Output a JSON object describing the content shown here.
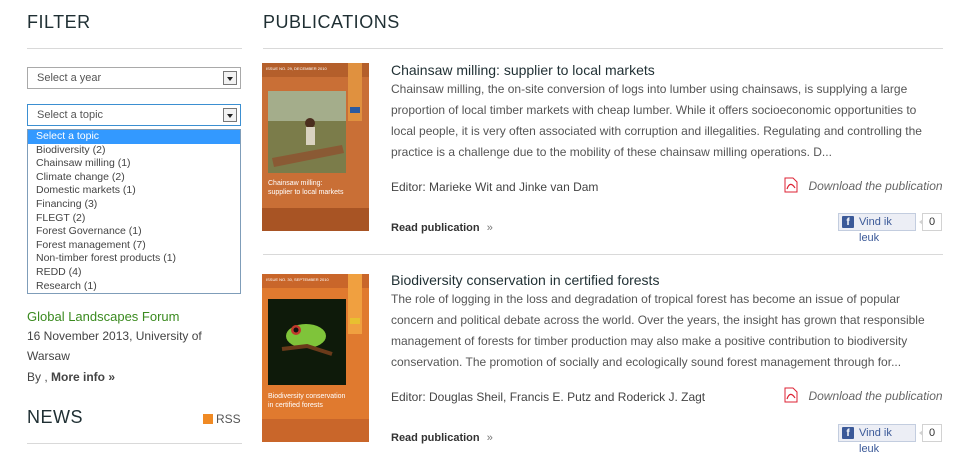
{
  "filter": {
    "heading": "FILTER",
    "year_select": "Select a year",
    "topic_select": "Select a topic",
    "topic_options": [
      "Select a topic",
      "Biodiversity (2)",
      "Chainsaw milling (1)",
      "Climate change (2)",
      "Domestic markets (1)",
      "Financing (3)",
      "FLEGT (2)",
      "Forest Governance (1)",
      "Forest management (7)",
      "Non-timber forest products (1)",
      "REDD (4)",
      "Research (1)"
    ]
  },
  "event": {
    "title": "Global Landscapes Forum",
    "date_line1": "16 November 2013, University of",
    "date_line2": "Warsaw",
    "by": "By ,",
    "more": "More info »"
  },
  "news": {
    "heading": "NEWS",
    "rss": "RSS"
  },
  "publications": {
    "heading": "PUBLICATIONS",
    "items": [
      {
        "title": "Chainsaw milling: supplier to local markets",
        "lines": [
          "Chainsaw milling, the on-site conversion of logs into lumber using chainsaws, is supplying a large",
          "proportion of local timber markets with cheap lumber. While it offers socioeconomic opportunities to",
          "local people, it is very often associated with corruption and illegalities. Regulating and controlling the",
          "practice is a challenge due to the mobility of these chainsaw milling operations. D..."
        ],
        "editor": "Editor: Marieke Wit and Jinke van Dam",
        "download": "Download the publication",
        "read": "Read publication",
        "like": "Vind ik leuk",
        "like_count": "0",
        "cover_title": "Chainsaw milling: supplier to local markets",
        "cover_issue": "ISSUE NO. 29, DECEMBER 2010"
      },
      {
        "title": "Biodiversity conservation in certified forests",
        "lines": [
          "The role of logging in the loss and degradation of tropical forest has become an issue of popular",
          "concern and political debate across the world. Over the years, the insight has grown that responsible",
          "management of forests for timber production may also make a positive contribution to biodiversity",
          "conservation. The promotion of socially and ecologically sound forest management through for..."
        ],
        "editor": "Editor: Douglas Sheil, Francis E. Putz and Roderick J. Zagt",
        "download": "Download the publication",
        "read": "Read publication",
        "like": "Vind ik leuk",
        "like_count": "0",
        "cover_title": "Biodiversity conservation in certified forests",
        "cover_issue": "ISSUE NO. 30, SEPTEMBER 2010"
      }
    ]
  }
}
